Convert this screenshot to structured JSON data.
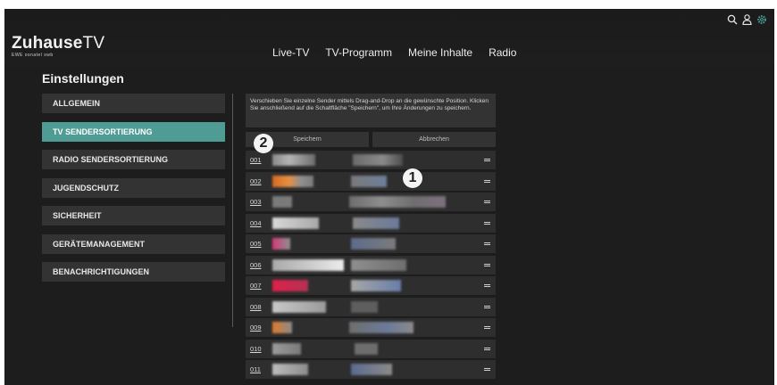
{
  "app": {
    "brand": "Zuhause",
    "brand_suffix": "TV",
    "sub": "EWE osnatel swb"
  },
  "nav": {
    "items": [
      "Live-TV",
      "TV-Programm",
      "Meine Inhalte",
      "Radio"
    ]
  },
  "header_icons": [
    "search-icon",
    "user-icon",
    "settings-icon"
  ],
  "page": {
    "title": "Einstellungen"
  },
  "menu": {
    "items": [
      {
        "label": "ALLGEMEIN",
        "active": false
      },
      {
        "label": "TV SENDERSORTIERUNG",
        "active": true
      },
      {
        "label": "RADIO SENDERSORTIERUNG",
        "active": false
      },
      {
        "label": "JUGENDSCHUTZ",
        "active": false
      },
      {
        "label": "SICHERHEIT",
        "active": false
      },
      {
        "label": "GERÄTEMANAGEMENT",
        "active": false
      },
      {
        "label": "BENACHRICHTIGUNGEN",
        "active": false
      }
    ]
  },
  "panel": {
    "info": "Verschieben Sie einzelne Sender mittels Drag-and-Drop an die gewünschte Position. Klicken Sie anschließend auf die Schaltfläche \"Speichern\", um Ihre Änderungen zu speichern.",
    "save_label": "Speichern",
    "cancel_label": "Abbrechen",
    "channels": [
      "001",
      "002",
      "003",
      "004",
      "005",
      "006",
      "007",
      "008",
      "009",
      "010",
      "011"
    ]
  },
  "badges": {
    "one": "1",
    "two": "2"
  },
  "colors": {
    "accent": "#4e9c93",
    "background": "#1d1d1d",
    "item": "#333333"
  }
}
